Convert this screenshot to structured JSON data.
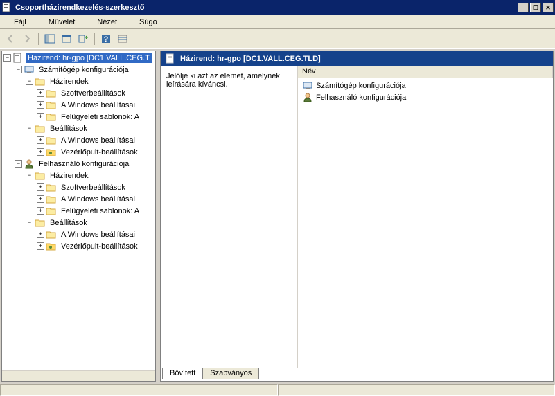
{
  "window": {
    "title": "Csoportházirendkezelés-szerkesztő"
  },
  "menu": {
    "file": "Fájl",
    "action": "Művelet",
    "view": "Nézet",
    "help": "Súgó"
  },
  "tree": {
    "root": "Házirend: hr-gpo [DC1.VALL.CEG.T",
    "computer_config": "Számítógép konfigurációja",
    "policies": "Házirendek",
    "software_settings": "Szoftverbeállítások",
    "windows_settings": "A Windows beállításai",
    "admin_templates": "Felügyeleti sablonok: A",
    "preferences": "Beállítások",
    "windows_settings2": "A Windows beállításai",
    "cpanel_settings": "Vezérlőpult-beállítások",
    "user_config": "Felhasználó konfigurációja"
  },
  "details": {
    "header": "Házirend: hr-gpo [DC1.VALL.CEG.TLD]",
    "hint": "Jelölje ki azt az elemet, amelynek leírására kíváncsi.",
    "col_name": "Név",
    "item1": "Számítógép konfigurációja",
    "item2": "Felhasználó konfigurációja"
  },
  "tabs": {
    "extended": "Bővített",
    "standard": "Szabványos"
  }
}
